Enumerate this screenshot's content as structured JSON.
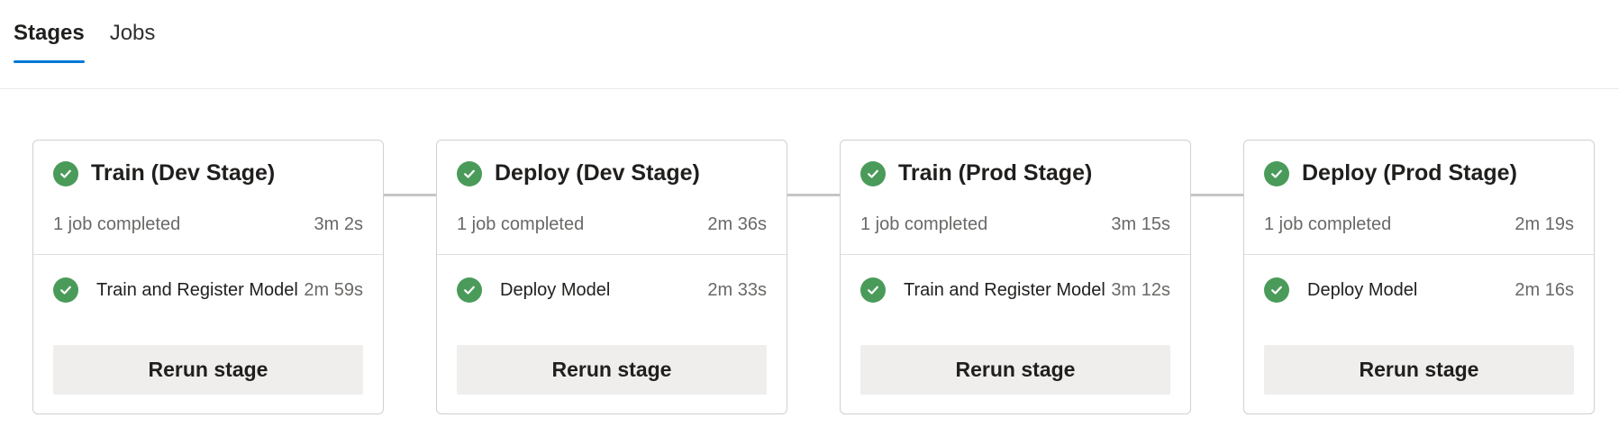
{
  "tabs": [
    {
      "label": "Stages",
      "active": true
    },
    {
      "label": "Jobs",
      "active": false
    }
  ],
  "colors": {
    "accent": "#0078d4",
    "success": "#4a9b5a"
  },
  "stages": [
    {
      "title": "Train (Dev Stage)",
      "status_icon": "check-circle-icon",
      "summary": "1 job completed",
      "duration": "3m 2s",
      "job": {
        "name": "Train and Register Model",
        "duration": "2m 59s"
      },
      "rerun_label": "Rerun stage"
    },
    {
      "title": "Deploy (Dev Stage)",
      "status_icon": "check-circle-icon",
      "summary": "1 job completed",
      "duration": "2m 36s",
      "job": {
        "name": "Deploy Model",
        "duration": "2m 33s"
      },
      "rerun_label": "Rerun stage"
    },
    {
      "title": "Train (Prod Stage)",
      "status_icon": "check-circle-icon",
      "summary": "1 job completed",
      "duration": "3m 15s",
      "job": {
        "name": "Train and Register Model",
        "duration": "3m 12s"
      },
      "rerun_label": "Rerun stage"
    },
    {
      "title": "Deploy (Prod Stage)",
      "status_icon": "check-circle-icon",
      "summary": "1 job completed",
      "duration": "2m 19s",
      "job": {
        "name": "Deploy Model",
        "duration": "2m 16s"
      },
      "rerun_label": "Rerun stage"
    }
  ]
}
